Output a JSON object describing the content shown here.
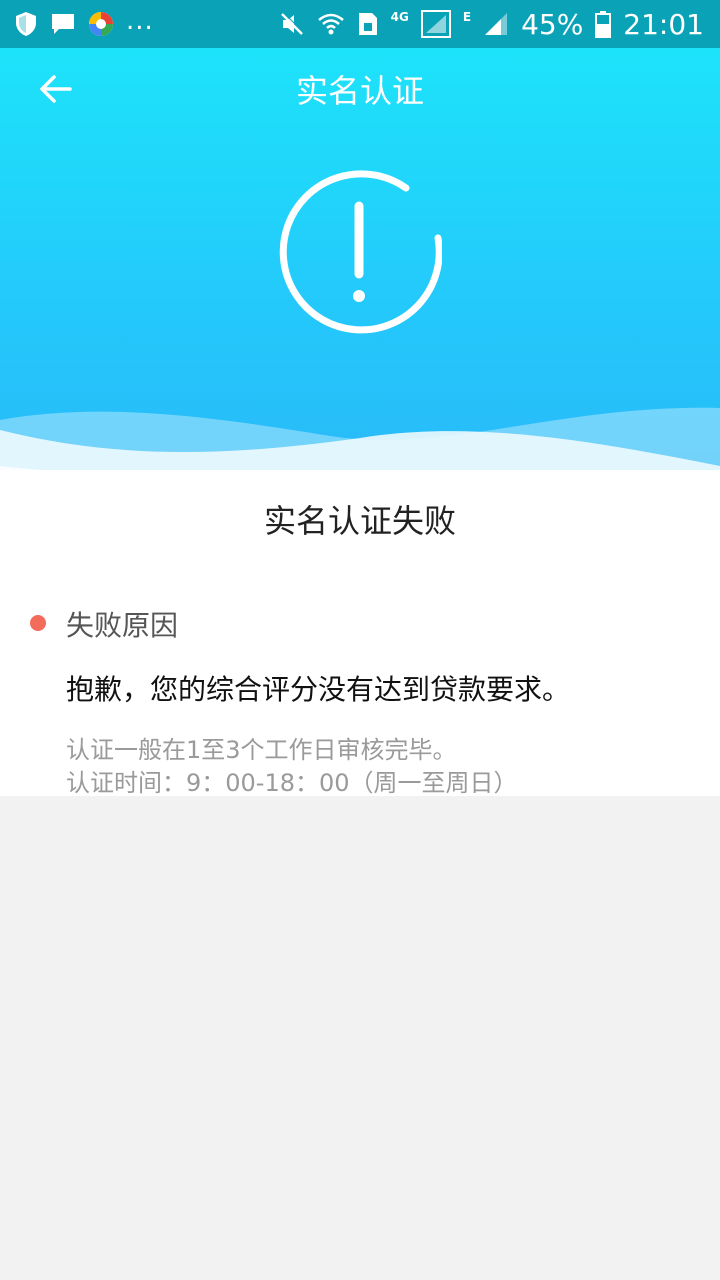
{
  "status_bar": {
    "notification_more": "...",
    "network_4g": "4G",
    "network_e": "E",
    "battery_percent": "45%",
    "time": "21:01",
    "icons": [
      "shield-icon",
      "message-icon",
      "app-icon",
      "mute-icon",
      "wifi-icon",
      "sim-icon",
      "signal-icon",
      "battery-icon"
    ]
  },
  "header": {
    "title": "实名认证",
    "back_icon": "arrow-left-icon"
  },
  "hero": {
    "icon": "alert-circle-icon"
  },
  "result": {
    "title": "实名认证失败",
    "reason_label": "失败原因",
    "reason_text": "抱歉，您的综合评分没有达到贷款要求。",
    "note_line_1": "认证一般在1至3个工作日审核完毕。",
    "note_line_2": "认证时间：9：00-18：00（周一至周日）"
  },
  "colors": {
    "status_bar": "#0aa2b6",
    "hero_top": "#1de3fa",
    "hero_bottom": "#2bb3f6",
    "reason_dot": "#f26b5b",
    "page_background": "#f2f2f2"
  }
}
